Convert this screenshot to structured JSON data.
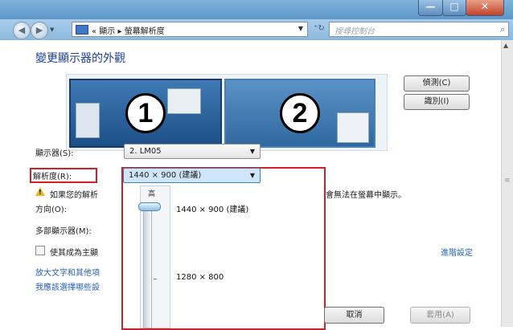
{
  "window": {
    "minimize_label": "—",
    "maximize_label": "□",
    "close_label": "✕"
  },
  "nav": {
    "breadcrumb": "« 顯示 ▸ 螢幕解析度",
    "search_placeholder": "搜尋控制台"
  },
  "page": {
    "title": "變更顯示器的外觀"
  },
  "monitors": {
    "monitor1_number": "1",
    "monitor2_number": "2",
    "detect_label": "偵測(C)",
    "identify_label": "識別(I)"
  },
  "form": {
    "display_label": "顯示器(S):",
    "display_value": "2. LM05",
    "resolution_label": "解析度(R):",
    "resolution_value": "1440 × 900 (建議)",
    "warning_text_left": "如果您的解析",
    "warning_text_right": "會無法在螢幕中顯示。",
    "orientation_label": "方向(O):",
    "multi_display_label": "多部顯示器(M):",
    "make_main_label": "使其成為主顯",
    "advanced_link": "進階設定",
    "link_text_size": "放大文字和其他項",
    "link_which_setting": "我應該選擇哪些設"
  },
  "dropdown": {
    "high_label": "高",
    "option_recommended": "1440 × 900 (建議)",
    "option_other": "1280 × 800"
  },
  "buttons": {
    "cancel_label": "取消",
    "apply_label": "套用(A)"
  },
  "colors": {
    "highlight": "#d41e27",
    "link": "#2a62b8",
    "title": "#1e3f9a"
  },
  "icons": {
    "back": "back-arrow-icon",
    "forward": "forward-arrow-icon",
    "warning": "warning-icon",
    "search": "search-icon"
  }
}
